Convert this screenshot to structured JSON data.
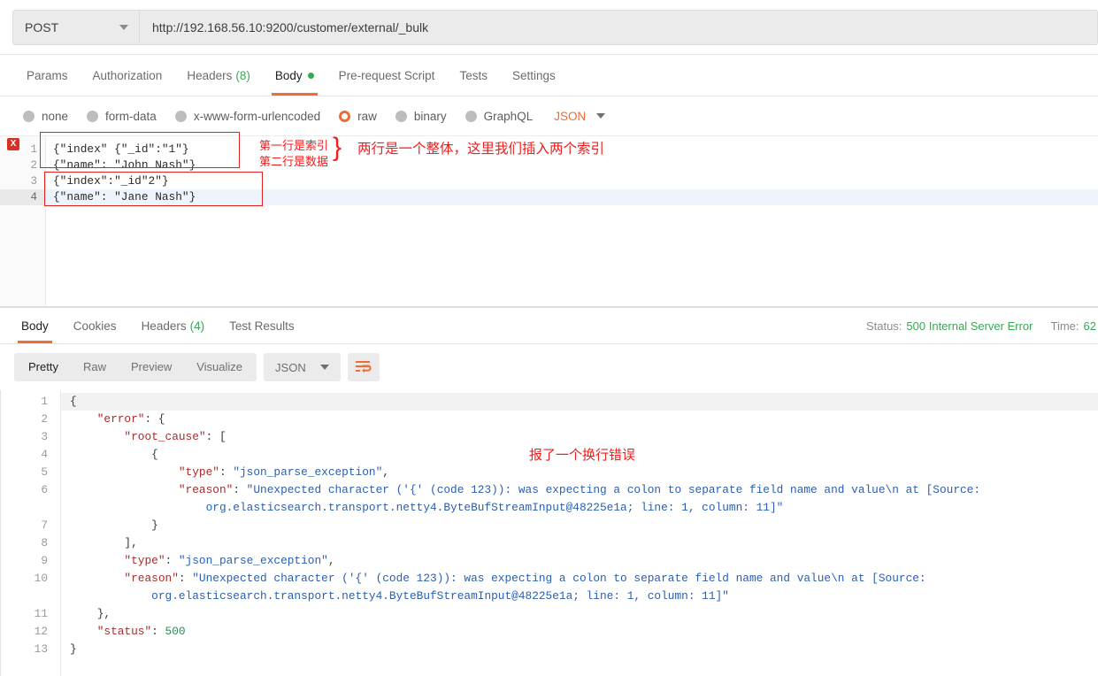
{
  "request": {
    "method": "POST",
    "url": "http://192.168.56.10:9200/customer/external/_bulk",
    "tabs": [
      {
        "label": "Params",
        "active": false
      },
      {
        "label": "Authorization",
        "active": false
      },
      {
        "label": "Headers",
        "count": "(8)",
        "active": false
      },
      {
        "label": "Body",
        "dot": true,
        "active": true
      },
      {
        "label": "Pre-request Script",
        "active": false
      },
      {
        "label": "Tests",
        "active": false
      },
      {
        "label": "Settings",
        "active": false
      }
    ],
    "body_types": [
      {
        "label": "none",
        "selected": false
      },
      {
        "label": "form-data",
        "selected": false
      },
      {
        "label": "x-www-form-urlencoded",
        "selected": false
      },
      {
        "label": "raw",
        "selected": true
      },
      {
        "label": "binary",
        "selected": false
      },
      {
        "label": "GraphQL",
        "selected": false
      }
    ],
    "format": "JSON",
    "editor": {
      "error_badge": "X",
      "lines": [
        {
          "num": "1",
          "text": "{\"index\" {\"_id\":\"1\"}",
          "highlight": false
        },
        {
          "num": "2",
          "text": "{\"name\": \"John Nash\"}",
          "highlight": false
        },
        {
          "num": "3",
          "text": "{\"index\":\"_id\"2\"}",
          "highlight": false
        },
        {
          "num": "4",
          "text": "{\"name\": \"Jane Nash\"}",
          "highlight": true
        }
      ]
    },
    "annotations": {
      "line1_note": "第一行是索引",
      "line2_note": "第二行是数据",
      "brace": "}",
      "main_note": "两行是一个整体，这里我们插入两个索引"
    }
  },
  "response": {
    "tabs": [
      {
        "label": "Body",
        "active": true
      },
      {
        "label": "Cookies",
        "active": false
      },
      {
        "label": "Headers",
        "count": "(4)",
        "active": false
      },
      {
        "label": "Test Results",
        "active": false
      }
    ],
    "status_label": "Status:",
    "status_value": "500 Internal Server Error",
    "time_label": "Time:",
    "time_value": "62",
    "view_modes": [
      {
        "label": "Pretty",
        "active": true
      },
      {
        "label": "Raw",
        "active": false
      },
      {
        "label": "Preview",
        "active": false
      },
      {
        "label": "Visualize",
        "active": false
      }
    ],
    "format": "JSON",
    "wrap_icon": "wrap-lines-icon",
    "annotation": "报了一个换行错误",
    "lines": [
      {
        "num": "1",
        "segs": [
          {
            "t": "{",
            "c": "pnc"
          }
        ]
      },
      {
        "num": "2",
        "segs": [
          {
            "t": "    \"error\"",
            "c": "key"
          },
          {
            "t": ": {",
            "c": "pnc"
          }
        ]
      },
      {
        "num": "3",
        "segs": [
          {
            "t": "        \"root_cause\"",
            "c": "key"
          },
          {
            "t": ": [",
            "c": "pnc"
          }
        ]
      },
      {
        "num": "4",
        "segs": [
          {
            "t": "            {",
            "c": "pnc"
          }
        ]
      },
      {
        "num": "5",
        "segs": [
          {
            "t": "                \"type\"",
            "c": "key"
          },
          {
            "t": ": ",
            "c": "pnc"
          },
          {
            "t": "\"json_parse_exception\"",
            "c": "str2"
          },
          {
            "t": ",",
            "c": "pnc"
          }
        ]
      },
      {
        "num": "6",
        "segs": [
          {
            "t": "                \"reason\"",
            "c": "key"
          },
          {
            "t": ": ",
            "c": "pnc"
          },
          {
            "t": "\"Unexpected character ('{' (code 123)): was expecting a colon to separate field name and value\\n at [Source:",
            "c": "str2"
          }
        ]
      },
      {
        "num": "",
        "segs": [
          {
            "t": "                    org.elasticsearch.transport.netty4.ByteBufStreamInput@48225e1a; line: 1, column: 11]\"",
            "c": "str2"
          }
        ]
      },
      {
        "num": "7",
        "segs": [
          {
            "t": "            }",
            "c": "pnc"
          }
        ]
      },
      {
        "num": "8",
        "segs": [
          {
            "t": "        ],",
            "c": "pnc"
          }
        ]
      },
      {
        "num": "9",
        "segs": [
          {
            "t": "        \"type\"",
            "c": "key"
          },
          {
            "t": ": ",
            "c": "pnc"
          },
          {
            "t": "\"json_parse_exception\"",
            "c": "str2"
          },
          {
            "t": ",",
            "c": "pnc"
          }
        ]
      },
      {
        "num": "10",
        "segs": [
          {
            "t": "        \"reason\"",
            "c": "key"
          },
          {
            "t": ": ",
            "c": "pnc"
          },
          {
            "t": "\"Unexpected character ('{' (code 123)): was expecting a colon to separate field name and value\\n at [Source:",
            "c": "str2"
          }
        ]
      },
      {
        "num": "",
        "segs": [
          {
            "t": "            org.elasticsearch.transport.netty4.ByteBufStreamInput@48225e1a; line: 1, column: 11]\"",
            "c": "str2"
          }
        ]
      },
      {
        "num": "11",
        "segs": [
          {
            "t": "    },",
            "c": "pnc"
          }
        ]
      },
      {
        "num": "12",
        "segs": [
          {
            "t": "    \"status\"",
            "c": "key"
          },
          {
            "t": ": ",
            "c": "pnc"
          },
          {
            "t": "500",
            "c": "num"
          }
        ]
      },
      {
        "num": "13",
        "segs": [
          {
            "t": "}",
            "c": "pnc"
          }
        ]
      }
    ]
  },
  "colors": {
    "accent": "#ef6c35",
    "success": "#3aa757",
    "annotation_red": "#f01e1e",
    "json_key": "#a82c2c",
    "json_string": "#2b5fb0",
    "json_number": "#2e8b57"
  }
}
